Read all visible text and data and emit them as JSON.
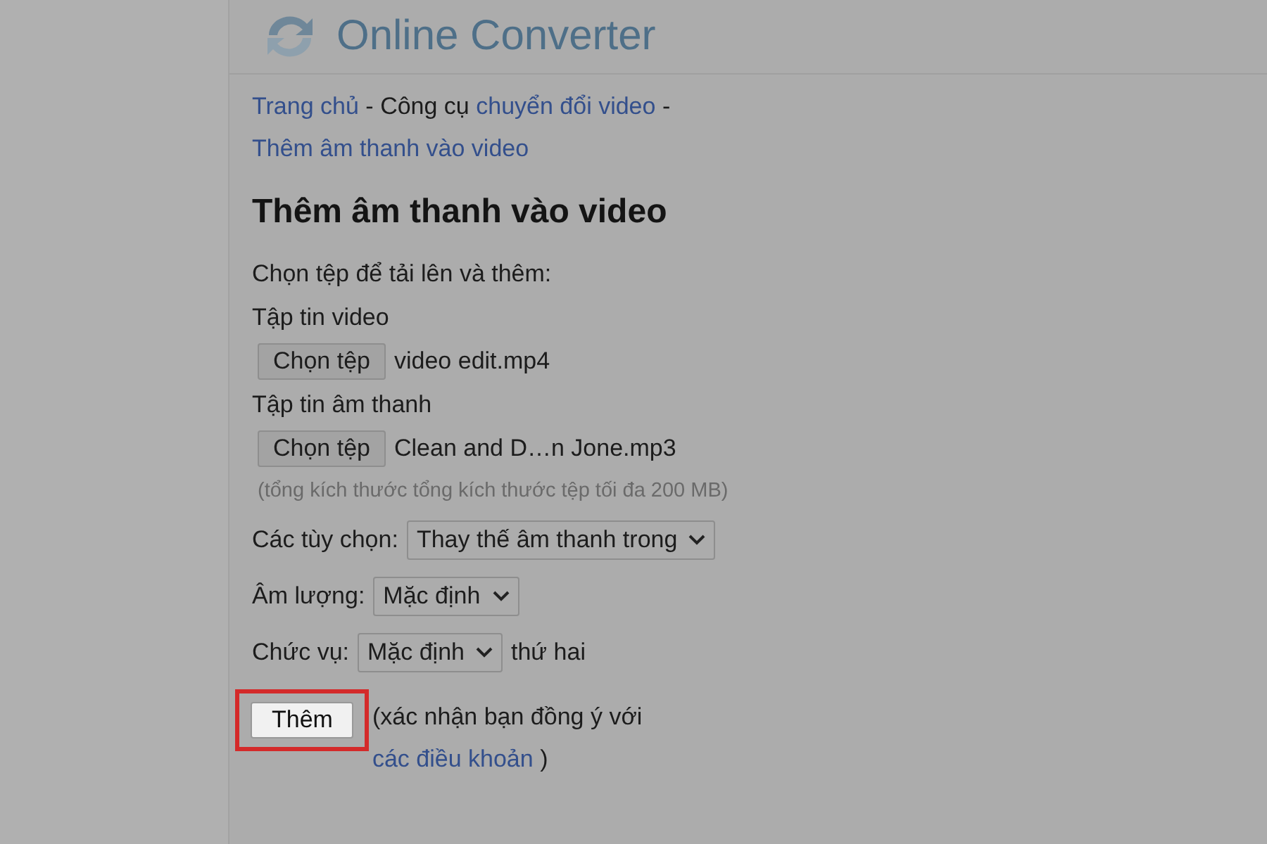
{
  "header": {
    "title": "Online Converter"
  },
  "breadcrumb": [
    {
      "text": "Trang chủ",
      "kind": "link"
    },
    {
      "text": "-",
      "kind": "text"
    },
    {
      "text": "Công cụ",
      "kind": "text"
    },
    {
      "text": "chuyển đổi video",
      "kind": "link"
    },
    {
      "text": "-",
      "kind": "text"
    },
    {
      "text": "Thêm âm thanh vào video",
      "kind": "link"
    }
  ],
  "heading": "Thêm âm thanh vào video",
  "intro": "Chọn tệp để tải lên và thêm:",
  "files": [
    {
      "label": "Tập tin video",
      "button": "Chọn tệp",
      "file": "video edit.mp4"
    },
    {
      "label": "Tập tin âm thanh",
      "button": "Chọn tệp",
      "file": "Clean and D…n Jone.mp3"
    }
  ],
  "note": "(tổng kích thước tổng kích thước tệp tối đa 200 MB)",
  "options": [
    {
      "label": "Các tùy chọn:",
      "value": "Thay thế âm thanh trong"
    },
    {
      "label": "Âm lượng:",
      "value": "Mặc định"
    },
    {
      "label": "Chức vụ:",
      "value": "Mặc định",
      "suffix": "thứ hai"
    }
  ],
  "submit": {
    "label": "Thêm",
    "highlighted": true,
    "agreement": "(xác nhận bạn đồng ý với",
    "terms_link": "các điều khoản",
    "closing": ")"
  }
}
